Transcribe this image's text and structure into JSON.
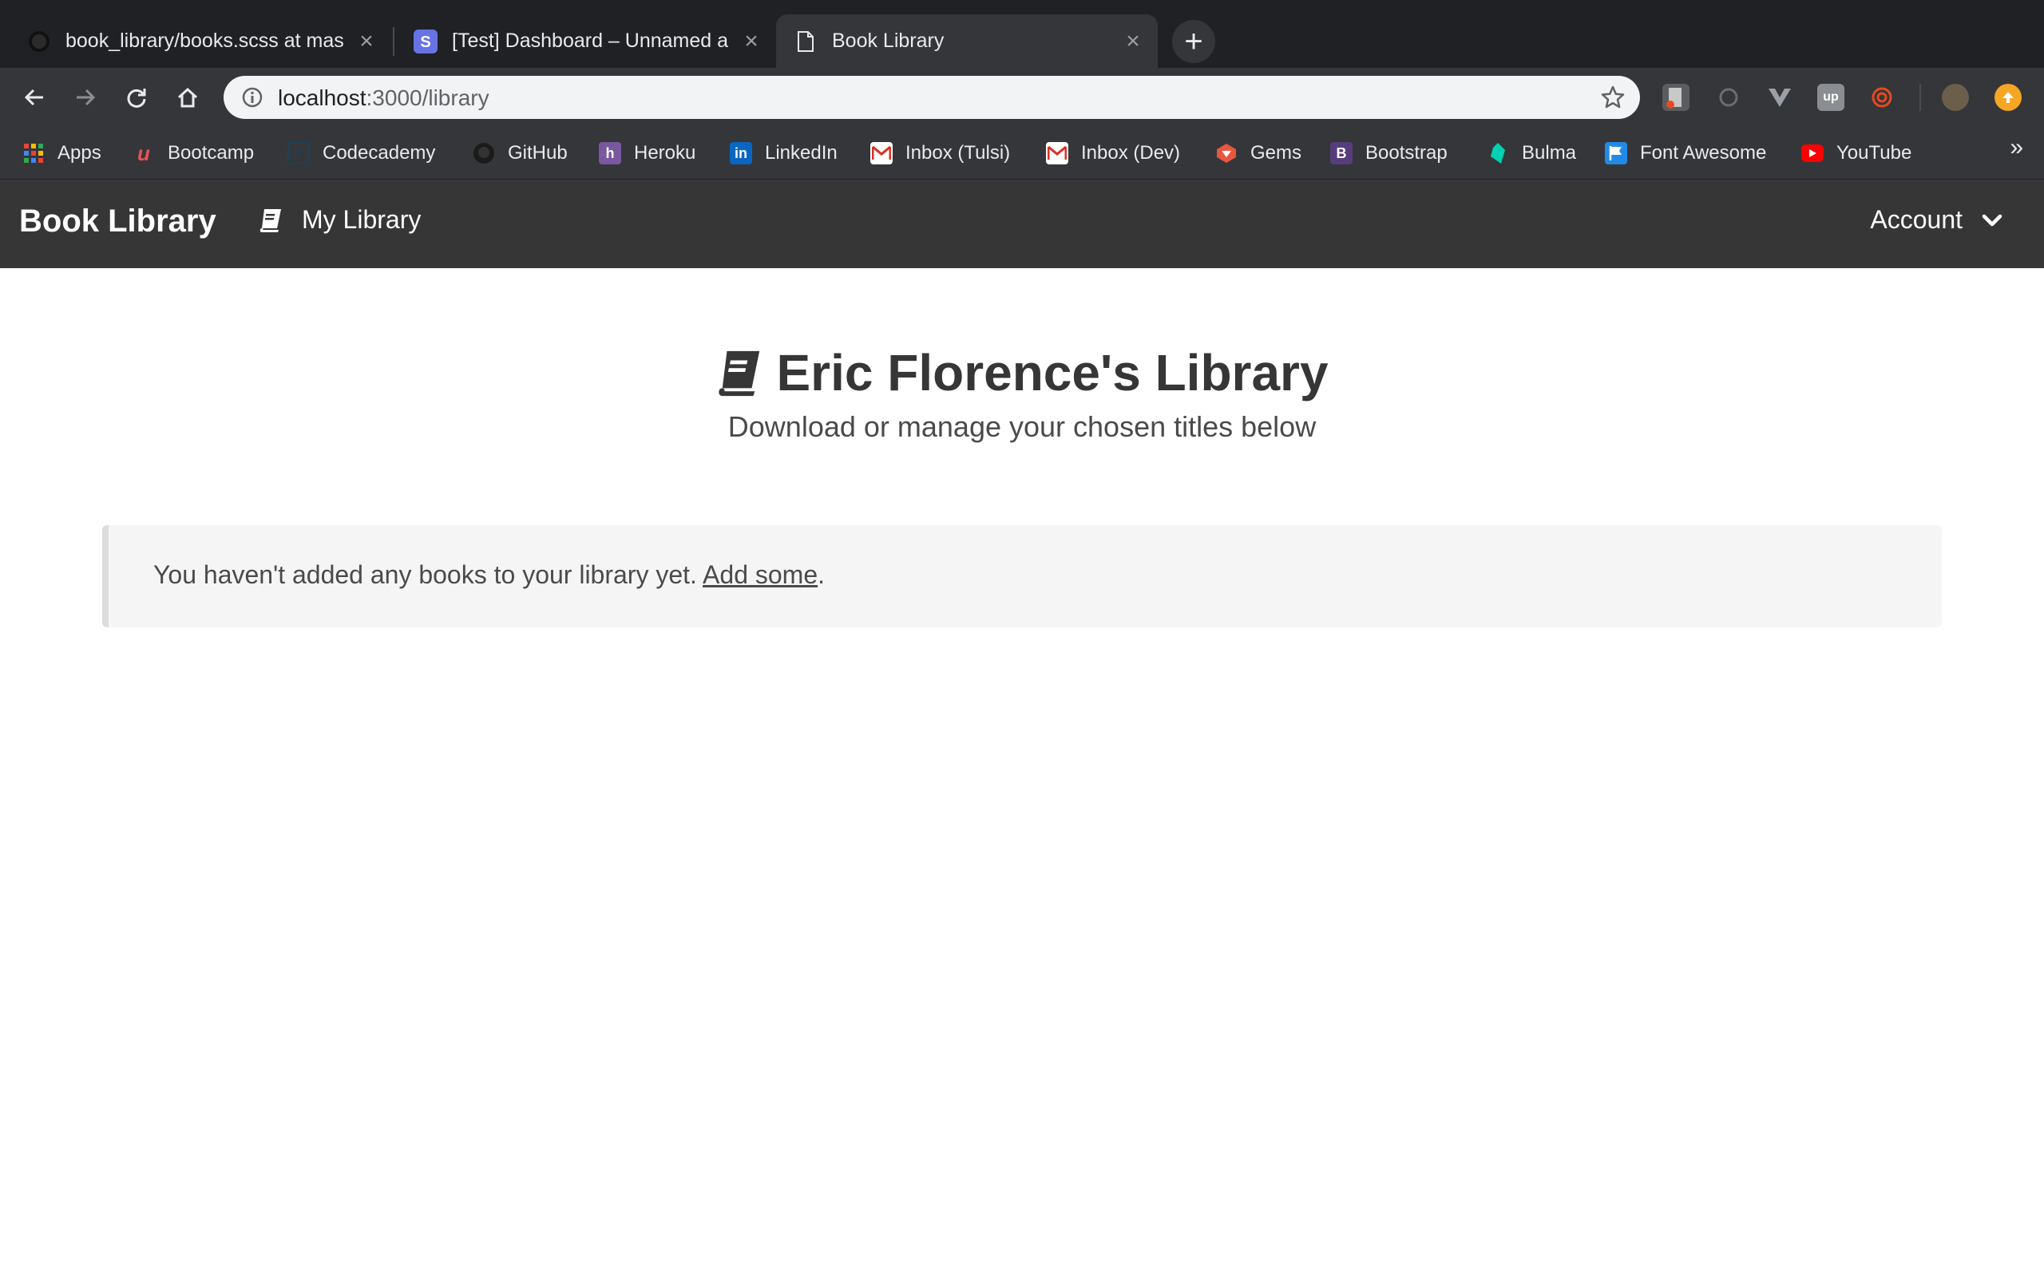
{
  "browser": {
    "tabs": [
      {
        "title": "book_library/books.scss at mas",
        "favicon": "github-icon"
      },
      {
        "title": "[Test] Dashboard – Unnamed a",
        "favicon": "stripe-icon"
      },
      {
        "title": "Book Library",
        "favicon": "page-icon",
        "active": true
      }
    ],
    "url_host": "localhost",
    "url_path": ":3000/library",
    "bookmarks": [
      {
        "label": "Apps",
        "icon": "apps-grid-icon"
      },
      {
        "label": "Bootcamp",
        "icon": "udemy-icon"
      },
      {
        "label": "Codecademy",
        "icon": "codecademy-icon"
      },
      {
        "label": "GitHub",
        "icon": "github-icon"
      },
      {
        "label": "Heroku",
        "icon": "heroku-icon"
      },
      {
        "label": "LinkedIn",
        "icon": "linkedin-icon"
      },
      {
        "label": "Inbox (Tulsi)",
        "icon": "gmail-icon"
      },
      {
        "label": "Inbox (Dev)",
        "icon": "gmail-icon"
      },
      {
        "label": "Gems",
        "icon": "ruby-icon"
      },
      {
        "label": "Bootstrap",
        "icon": "bootstrap-icon"
      },
      {
        "label": "Bulma",
        "icon": "bulma-icon"
      },
      {
        "label": "Font Awesome",
        "icon": "flag-icon"
      },
      {
        "label": "YouTube",
        "icon": "youtube-icon"
      }
    ],
    "bookmarks_overflow": "»"
  },
  "navbar": {
    "brand": "Book Library",
    "library_link": "My Library",
    "account": "Account"
  },
  "hero": {
    "title": "Eric Florence's Library",
    "subtitle": "Download or manage your chosen titles below"
  },
  "notice": {
    "text": "You haven't added any books to your library yet.",
    "link": "Add some",
    "suffix": "."
  },
  "colors": {
    "navbar_bg": "#363636",
    "notice_bg": "#f5f5f5",
    "text_dark": "#363636"
  }
}
